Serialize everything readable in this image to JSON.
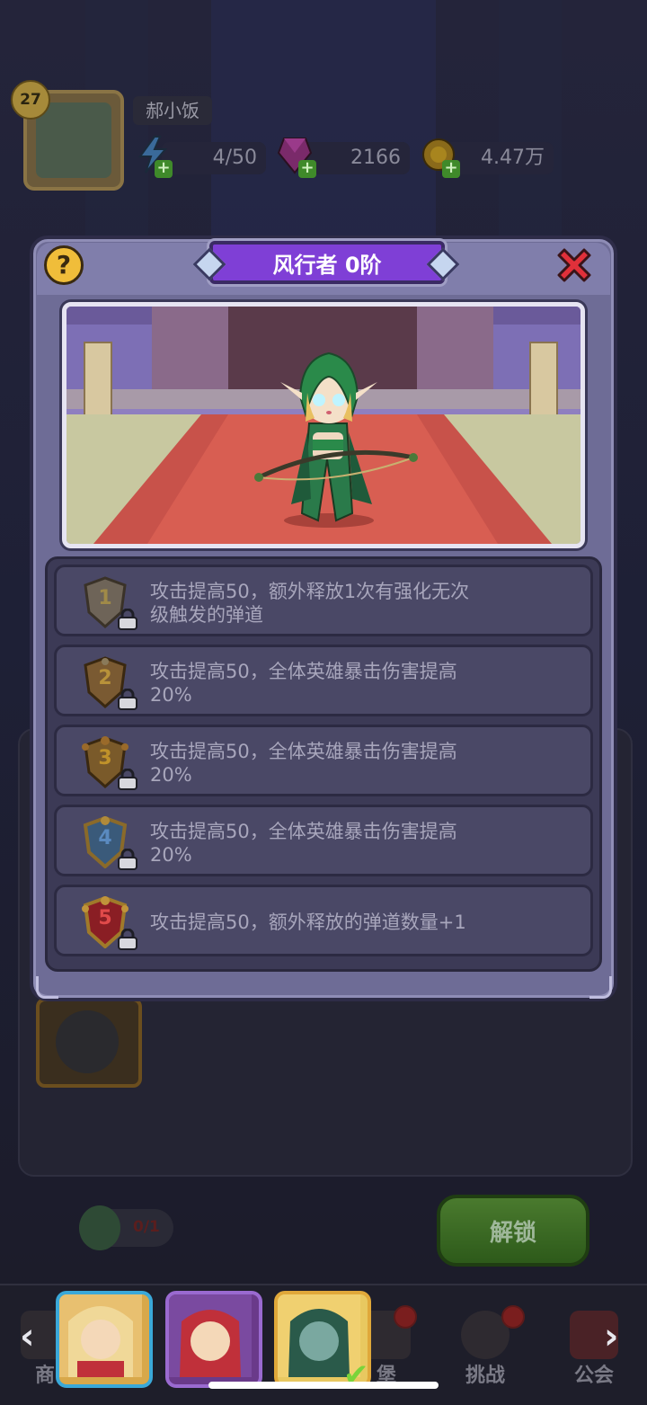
{
  "player": {
    "level": "27",
    "name": "郝小饭"
  },
  "resources": {
    "energy": "4/50",
    "gems": "2166",
    "gold": "4.47万"
  },
  "colors": {
    "title_plate": "#7f3fd6",
    "modal_bg": "#6e6c96",
    "close_red": "#e0303a",
    "help_gold": "#f0bd3a",
    "unlock_green": "#2d5a1a"
  },
  "modal": {
    "title": "风行者 0阶",
    "help_icon": "question-icon",
    "close_icon": "close-x-icon",
    "skills": [
      {
        "tier": "1",
        "locked": true,
        "text_line1": "攻击提高50，额外释放1次有强化无次",
        "text_line2": "级触发的弹道"
      },
      {
        "tier": "2",
        "locked": true,
        "text_line1": "攻击提高50，全体英雄暴击伤害提高",
        "text_line2": "20%"
      },
      {
        "tier": "3",
        "locked": true,
        "text_line1": "攻击提高50，全体英雄暴击伤害提高",
        "text_line2": "20%"
      },
      {
        "tier": "4",
        "locked": true,
        "text_line1": "攻击提高50，全体英雄暴击伤害提高",
        "text_line2": "20%"
      },
      {
        "tier": "5",
        "locked": true,
        "text_line1": "攻击提高50，额外释放的弹道数量+1",
        "text_line2": ""
      }
    ]
  },
  "background": {
    "unlock_label": "解锁",
    "progress_text": "0/1"
  },
  "nav": {
    "shop_label": "商",
    "fort_label": "堡",
    "challenge_label": "挑战",
    "guild_label": "公会",
    "prev_arrow": "‹",
    "next_arrow": "›"
  }
}
